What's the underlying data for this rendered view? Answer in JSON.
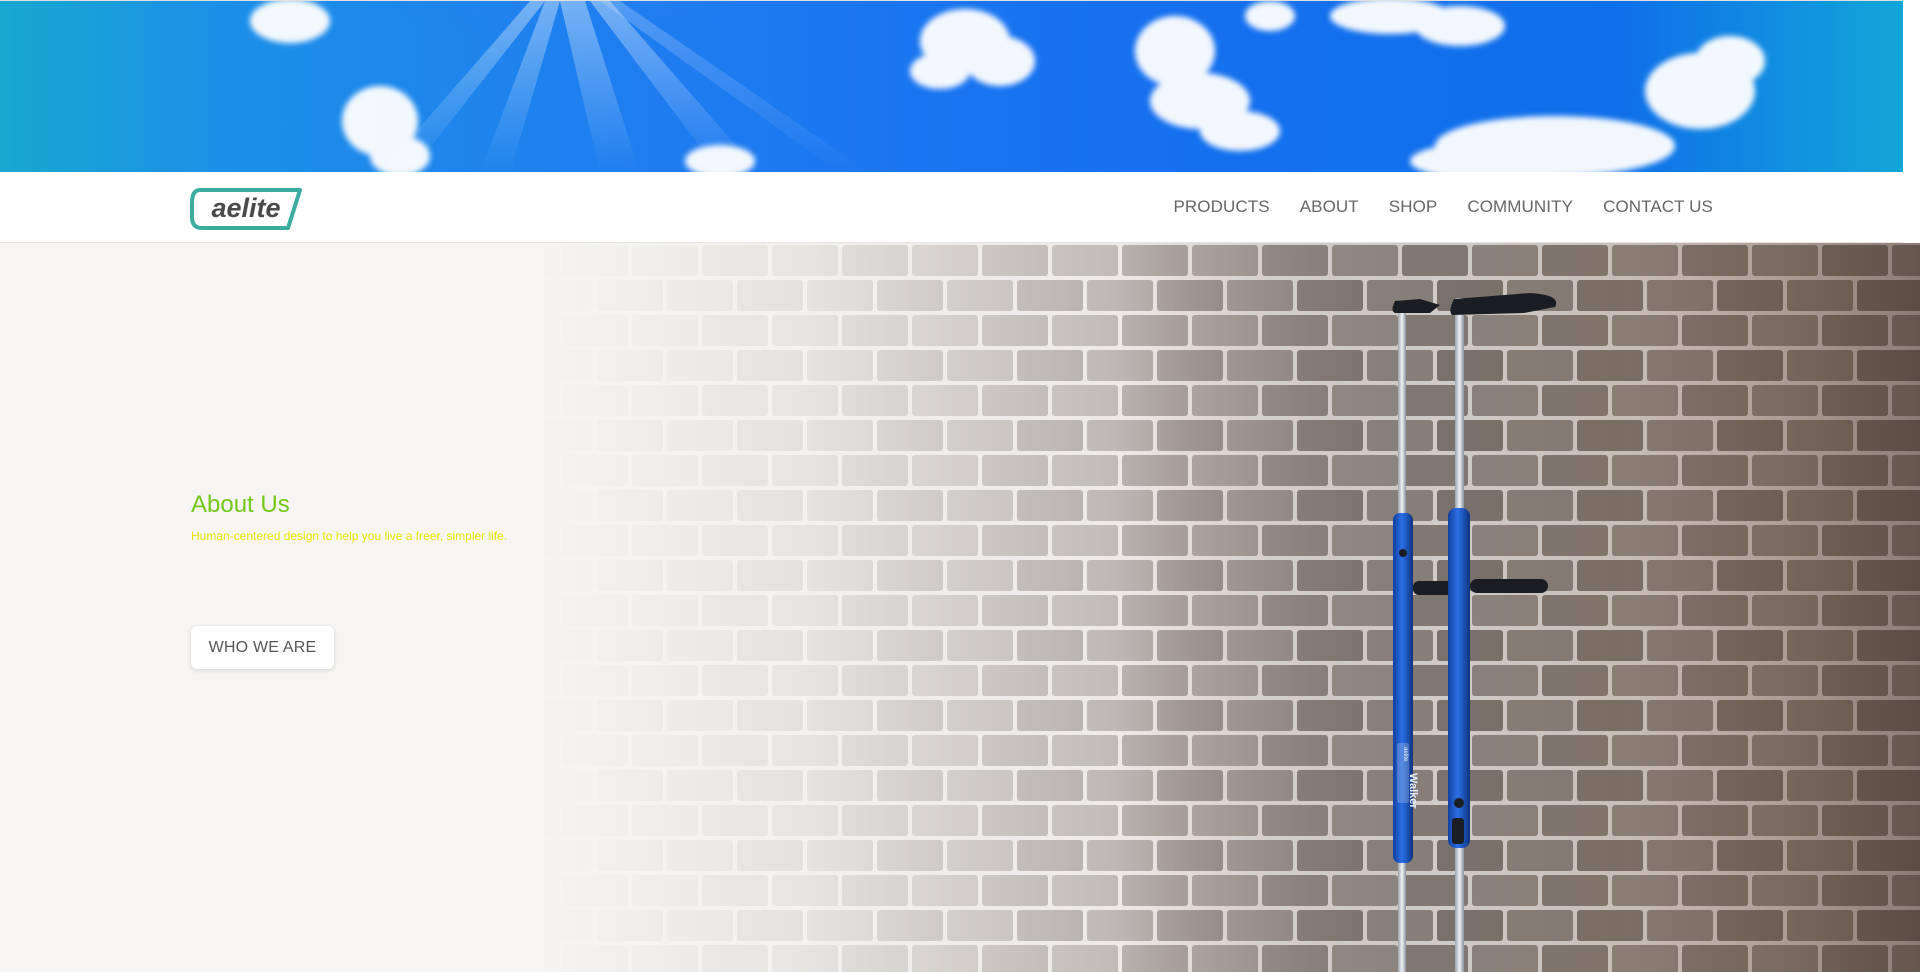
{
  "brand": {
    "logo_text": "aelite",
    "accent_color": "#3aada0"
  },
  "nav": {
    "items": [
      {
        "label": "PRODUCTS"
      },
      {
        "label": "ABOUT"
      },
      {
        "label": "SHOP"
      },
      {
        "label": "COMMUNITY"
      },
      {
        "label": "CONTACT US"
      }
    ]
  },
  "hero": {
    "title": "About Us",
    "subtitle": "Human-centered design to help you live a freer, simpler life.",
    "button_label": "WHO WE ARE",
    "title_color": "#74c81a",
    "subtitle_color": "#e6e600",
    "crutch_label": "Walker",
    "crutch_brand": "aelite"
  },
  "colors": {
    "sky_blue": "#1670ef",
    "crutch_blue": "#1f5fd6"
  }
}
